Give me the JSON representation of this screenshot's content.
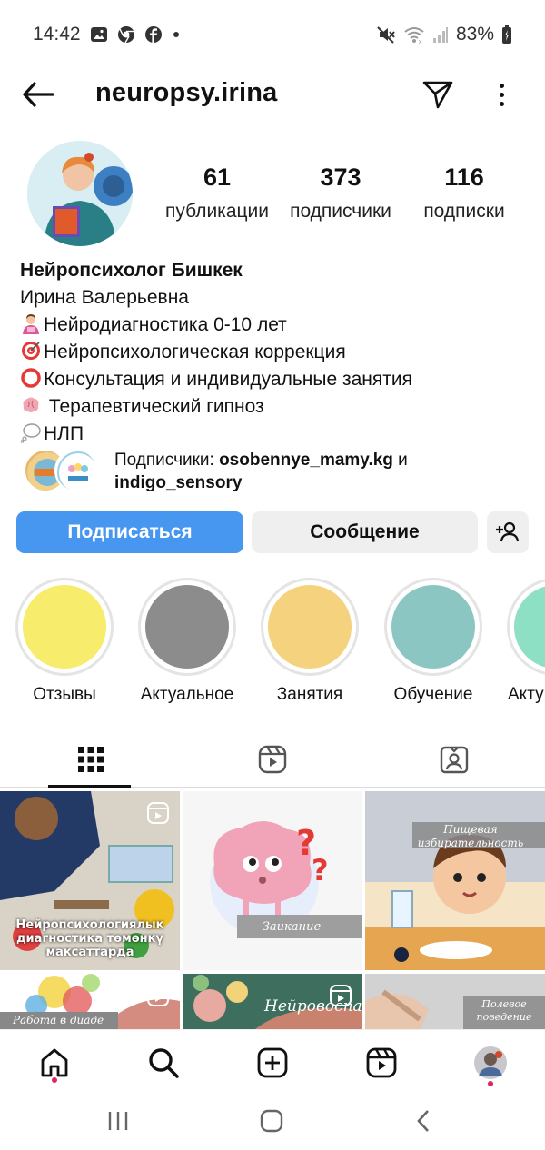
{
  "status_bar": {
    "time": "14:42",
    "battery": "83%",
    "left_icons": [
      "gallery-icon",
      "chrome-icon",
      "facebook-icon",
      "dot-icon"
    ],
    "right_icons": [
      "mute-icon",
      "wifi-icon",
      "signal-icon",
      "battery-icon"
    ]
  },
  "header": {
    "username": "neuropsy.irina"
  },
  "stats": [
    {
      "value": "61",
      "label": "публикации"
    },
    {
      "value": "373",
      "label": "подписчики"
    },
    {
      "value": "116",
      "label": "подписки"
    }
  ],
  "bio": {
    "name": "Нейропсихолог Бишкек",
    "lines": [
      "Ирина Валерьевна",
      "Нейродиагностика 0-10 лет",
      "Нейропсихологическая коррекция",
      "Консультация и индивидуальные занятия",
      " Терапевтический гипноз",
      "НЛП"
    ]
  },
  "followed_by": {
    "prefix": "Подписчики: ",
    "user1": "osobennye_mamy.kg",
    "joiner": " и",
    "user2": "indigo_sensory"
  },
  "buttons": {
    "follow": "Подписаться",
    "message": "Сообщение"
  },
  "highlights": [
    {
      "label": "Отзывы",
      "color": "#f7ec6c"
    },
    {
      "label": "Актуальное",
      "color": "#8c8c8c"
    },
    {
      "label": "Занятия",
      "color": "#f4d27e"
    },
    {
      "label": "Обучение",
      "color": "#8cc6c2"
    },
    {
      "label": "Акту",
      "color": "#8ee0c4"
    }
  ],
  "grid": {
    "captions": {
      "post1": "Нейропсихологиялык диагностика төмөнкү максаттарда",
      "post2": "Заикание",
      "post3": "Пищевая избирательность",
      "post4": "Работа в диаде",
      "post5": "Нейровоспал",
      "post6": "Полевое поведение"
    }
  },
  "colors": {
    "accent": "#4796f0",
    "notification": "#e0245e"
  }
}
